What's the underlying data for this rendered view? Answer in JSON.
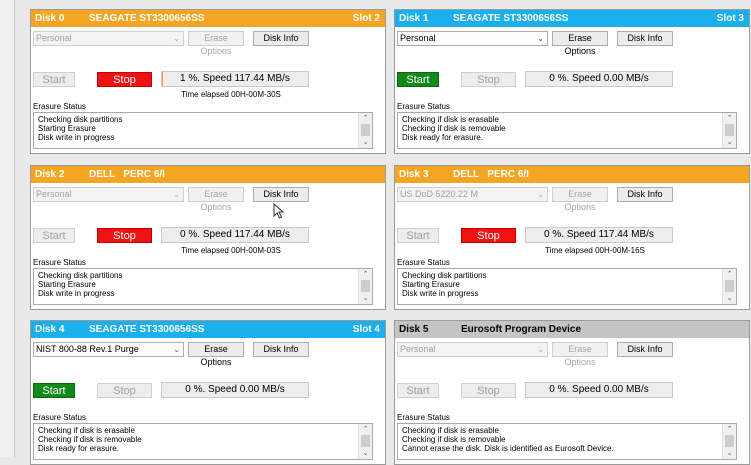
{
  "ui": {
    "erase_options": "Erase Options",
    "disk_info": "Disk Info",
    "start": "Start",
    "stop": "Stop",
    "erasure_status": "Erasure Status"
  },
  "colors": {
    "orange_header": "#f5a524",
    "blue_header": "#1ab0ee",
    "gray_header": "#c4c4c4",
    "start_active": "#128a19",
    "stop_active": "#ee1212"
  },
  "panels": [
    {
      "disk": "Disk 0",
      "model": "SEAGATE ST3300656SS",
      "slot": "Slot 2",
      "method": "Personal",
      "speed": "1 %. Speed 117.44 MB/s",
      "progress_percent": 1,
      "elapsed": "Time elapsed 00H-00M-30S",
      "status": [
        "Checking disk partitions",
        "Starting Erasure",
        "Disk write in progress"
      ]
    },
    {
      "disk": "Disk 1",
      "model": "SEAGATE ST3300656SS",
      "slot": "Slot 3",
      "method": "Personal",
      "speed": "0 %. Speed 0.00 MB/s",
      "progress_percent": 0,
      "elapsed": "",
      "status": [
        "Checking if disk is erasable",
        "Checking if disk is removable",
        "Disk ready for erasure."
      ]
    },
    {
      "disk": "Disk 2",
      "model": "DELL   PERC 6/I",
      "slot": "",
      "method": "Personal",
      "speed": "0 %. Speed 117.44 MB/s",
      "progress_percent": 0,
      "elapsed": "Time elapsed 00H-00M-03S",
      "status": [
        "Checking disk partitions",
        "Starting Erasure",
        "Disk write in progress"
      ]
    },
    {
      "disk": "Disk 3",
      "model": "DELL   PERC 6/I",
      "slot": "",
      "method": "US DoD 5220.22 M",
      "speed": "0 %. Speed 117.44 MB/s",
      "progress_percent": 0,
      "elapsed": "Time elapsed 00H-00M-16S",
      "status": [
        "Checking disk partitions",
        "Starting Erasure",
        "Disk write in progress"
      ]
    },
    {
      "disk": "Disk 4",
      "model": "SEAGATE ST3300656SS",
      "slot": "Slot 4",
      "method": "NIST 800-88 Rev.1 Purge",
      "speed": "0 %. Speed 0.00 MB/s",
      "progress_percent": 0,
      "elapsed": "",
      "status": [
        "Checking if disk is erasable",
        "Checking if disk is removable",
        "Disk ready for erasure."
      ]
    },
    {
      "disk": "Disk 5",
      "model": "Eurosoft Program Device",
      "slot": "",
      "method": "Personal",
      "speed": "0 %. Speed 0.00 MB/s",
      "progress_percent": 0,
      "elapsed": "",
      "status": [
        "Checking if disk is erasable",
        "Checking if disk is removable",
        "Cannot erase the disk. Disk is identified as Eurosoft Device."
      ]
    }
  ]
}
